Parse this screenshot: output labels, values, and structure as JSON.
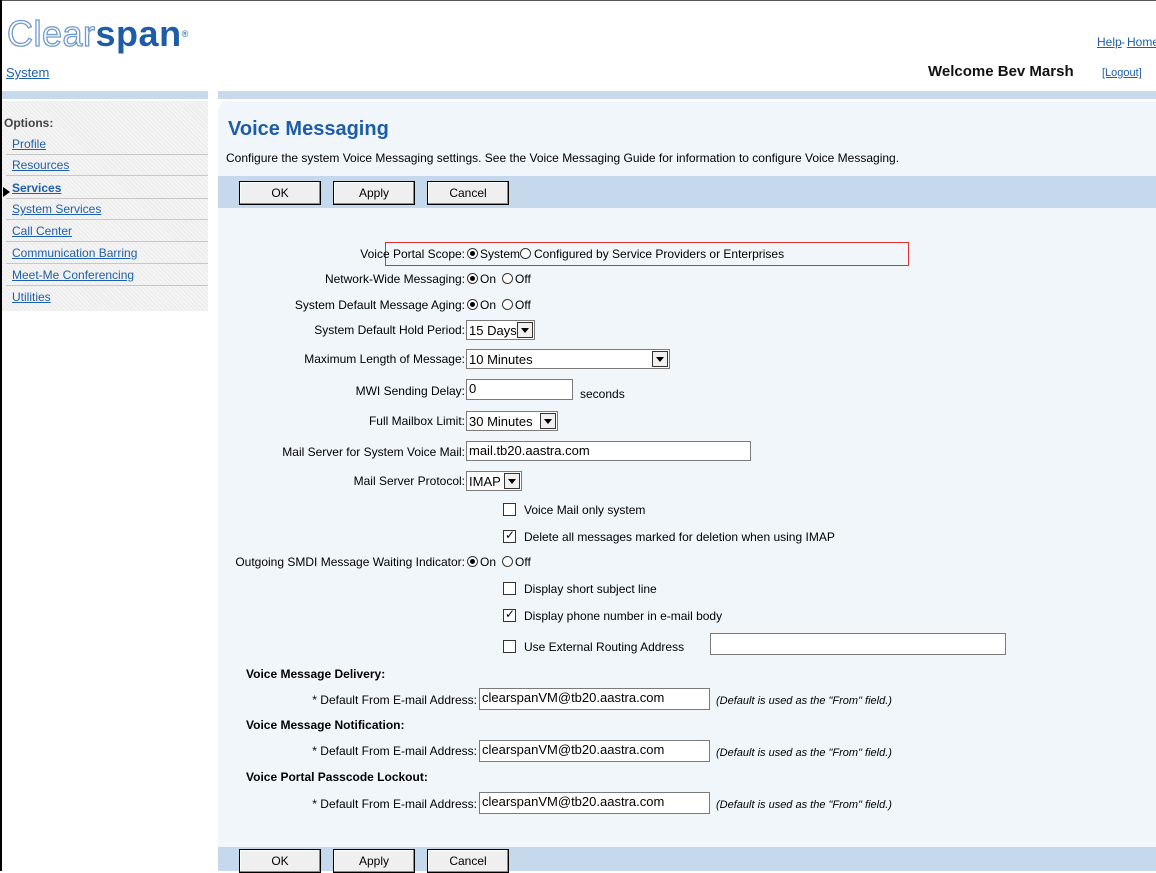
{
  "header": {
    "logo_clear": "Clear",
    "logo_span": "span",
    "logo_mark": "®",
    "help_link": "Help",
    "separator": "-",
    "home_link": "Home",
    "breadcrumb": "System",
    "welcome": "Welcome Bev Marsh",
    "logout_link": "[Logout]"
  },
  "nav": {
    "title": "Options:",
    "items": [
      {
        "label": "Profile",
        "active": false
      },
      {
        "label": "Resources",
        "active": false
      },
      {
        "label": "Services",
        "active": true
      },
      {
        "label": "System Services",
        "active": false
      },
      {
        "label": "Call Center",
        "active": false
      },
      {
        "label": "Communication Barring",
        "active": false
      },
      {
        "label": "Meet-Me Conferencing",
        "active": false
      },
      {
        "label": "Utilities",
        "active": false
      }
    ]
  },
  "page": {
    "title": "Voice Messaging",
    "description": "Configure the system Voice Messaging settings. See the Voice Messaging Guide for information to configure Voice Messaging."
  },
  "toolbar": {
    "ok": "OK",
    "apply": "Apply",
    "cancel": "Cancel"
  },
  "form": {
    "voice_portal_scope": {
      "label": "Voice Portal Scope:",
      "options": [
        "System",
        "Configured by Service Providers or Enterprises"
      ],
      "selected": "System"
    },
    "network_wide_messaging": {
      "label": "Network-Wide Messaging:",
      "on": "On",
      "off": "Off",
      "selected": "On"
    },
    "system_default_message_aging": {
      "label": "System Default Message Aging:",
      "on": "On",
      "off": "Off",
      "selected": "On"
    },
    "system_default_hold_period": {
      "label": "System Default Hold Period:",
      "value": "15 Days"
    },
    "maximum_length_of_message": {
      "label": "Maximum Length of Message:",
      "value": "10 Minutes"
    },
    "mwi_sending_delay": {
      "label": "MWI Sending Delay:",
      "value": "0",
      "unit": "seconds"
    },
    "full_mailbox_limit": {
      "label": "Full Mailbox Limit:",
      "value": "30 Minutes"
    },
    "mail_server": {
      "label": "Mail Server for System Voice Mail:",
      "value": "mail.tb20.aastra.com"
    },
    "mail_server_protocol": {
      "label": "Mail Server Protocol:",
      "value": "IMAP"
    },
    "voice_mail_only_system": {
      "label": "Voice Mail only system",
      "checked": false
    },
    "delete_marked_imap": {
      "label": "Delete all messages marked for deletion when using IMAP",
      "checked": true
    },
    "outgoing_smdi_mwi": {
      "label": "Outgoing SMDI Message Waiting Indicator:",
      "on": "On",
      "off": "Off",
      "selected": "On"
    },
    "display_short_subject": {
      "label": "Display short subject line",
      "checked": false
    },
    "display_phone_number": {
      "label": "Display phone number in e-mail body",
      "checked": true
    },
    "use_external_routing": {
      "label": "Use External Routing Address",
      "checked": false,
      "value": ""
    }
  },
  "sections": [
    {
      "heading": "Voice Message Delivery:",
      "field_label": "* Default From E-mail Address:",
      "value": "clearspanVM@tb20.aastra.com",
      "note": "(Default is used as the \"From\" field.)"
    },
    {
      "heading": "Voice Message Notification:",
      "field_label": "* Default From E-mail Address:",
      "value": "clearspanVM@tb20.aastra.com",
      "note": "(Default is used as the \"From\" field.)"
    },
    {
      "heading": "Voice Portal Passcode Lockout:",
      "field_label": "* Default From E-mail Address:",
      "value": "clearspanVM@tb20.aastra.com",
      "note": "(Default is used as the \"From\" field.)"
    }
  ],
  "colors": {
    "brand_blue": "#1e5ca8",
    "link": "#1f5fa8",
    "toolbar_bg": "#c6d8ec",
    "content_bg": "#f1f6fb",
    "highlight": "#e03030"
  }
}
